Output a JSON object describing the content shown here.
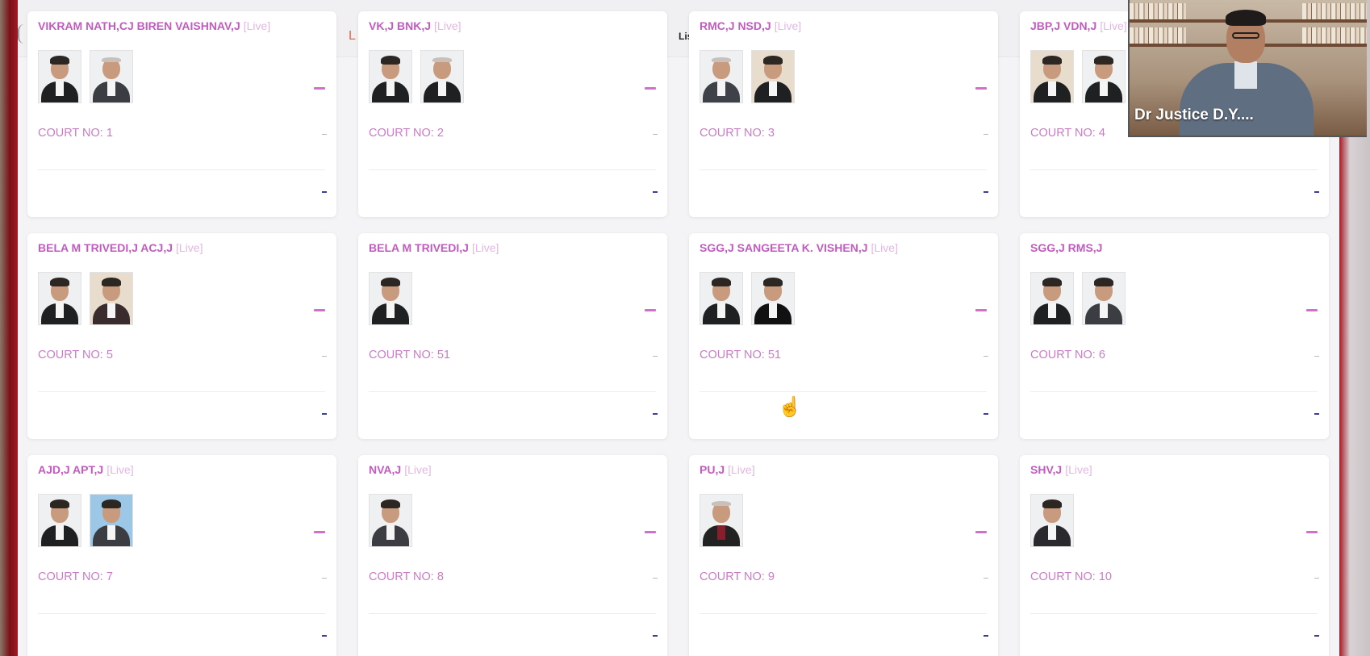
{
  "header_fragments": {
    "left": "L",
    "mid": "Lis"
  },
  "live_label": "[Live]",
  "cards": [
    {
      "title": "VIKRAM NATH,CJ BIREN VAISHNAV,J",
      "live": true,
      "court": "COURT NO: 1",
      "photos": 2
    },
    {
      "title": "VK,J BNK,J",
      "live": true,
      "court": "COURT NO: 2",
      "photos": 2
    },
    {
      "title": "RMC,J NSD,J",
      "live": true,
      "court": "COURT NO: 3",
      "photos": 2
    },
    {
      "title": "JBP,J VDN,J",
      "live": true,
      "court": "COURT NO: 4",
      "photos": 2
    },
    {
      "title": "BELA M TRIVEDI,J ACJ,J",
      "live": true,
      "court": "COURT NO: 5",
      "photos": 2
    },
    {
      "title": "BELA M TRIVEDI,J",
      "live": true,
      "court": "COURT NO: 51",
      "photos": 1
    },
    {
      "title": "SGG,J SANGEETA K. VISHEN,J",
      "live": true,
      "court": "COURT NO: 51",
      "photos": 2
    },
    {
      "title": "SGG,J RMS,J",
      "live": false,
      "court": "COURT NO: 6",
      "photos": 2
    },
    {
      "title": "AJD,J APT,J",
      "live": true,
      "court": "COURT NO: 7",
      "photos": 2
    },
    {
      "title": "NVA,J",
      "live": true,
      "court": "COURT NO: 8",
      "photos": 1
    },
    {
      "title": "PU,J",
      "live": true,
      "court": "COURT NO: 9",
      "photos": 1
    },
    {
      "title": "SHV,J",
      "live": true,
      "court": "COURT NO: 10",
      "photos": 1
    }
  ],
  "video_overlay": {
    "participant_name": "Dr Justice D.Y...."
  }
}
